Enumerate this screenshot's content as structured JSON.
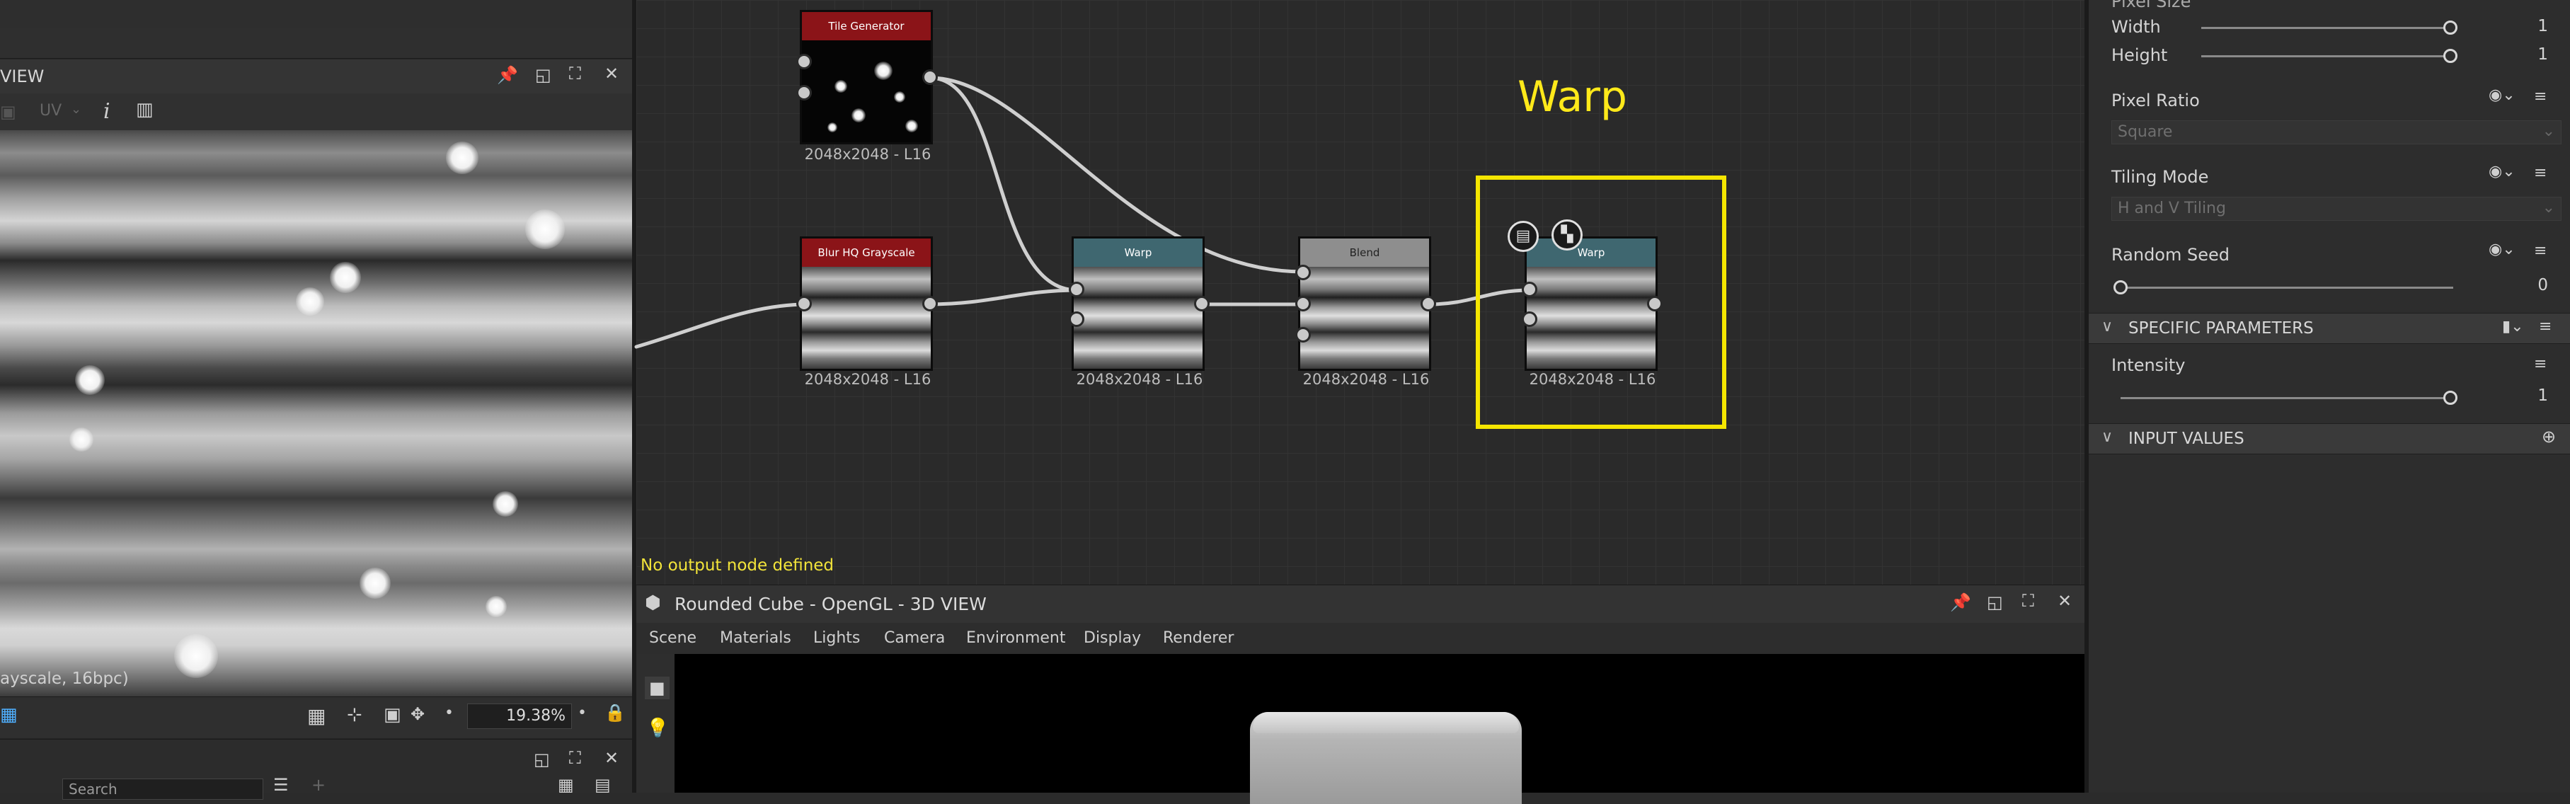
{
  "left_view": {
    "title": "VIEW",
    "uv_label": "UV",
    "status": "ayscale, 16bpc)",
    "zoom": "19.38%",
    "search_placeholder": "Search"
  },
  "graph": {
    "comment": "Warp",
    "no_output": "No output node defined",
    "nodes": [
      {
        "name": "Tile Generator",
        "color": "#8b1418",
        "label": "2048x2048 - L16"
      },
      {
        "name": "Blur HQ Grayscale",
        "color": "#8b1418",
        "label": "2048x2048 - L16"
      },
      {
        "name": "Warp",
        "color": "#3f6770",
        "label": "2048x2048 - L16"
      },
      {
        "name": "Blend",
        "color": "#8e8e8e",
        "label": "2048x2048 - L16"
      },
      {
        "name": "Warp",
        "color": "#3f6770",
        "label": "2048x2048 - L16"
      }
    ]
  },
  "view3d": {
    "title": "Rounded Cube - OpenGL - 3D VIEW",
    "menu": [
      "Scene",
      "Materials",
      "Lights",
      "Camera",
      "Environment",
      "Display",
      "Renderer"
    ]
  },
  "props": {
    "pixel_size_label": "Pixel Size",
    "width_label": "Width",
    "width_value": "1",
    "height_label": "Height",
    "height_value": "1",
    "pixel_ratio_label": "Pixel Ratio",
    "pixel_ratio_value": "Square",
    "tiling_mode_label": "Tiling Mode",
    "tiling_mode_value": "H and V Tiling",
    "random_seed_label": "Random Seed",
    "random_seed_value": "0",
    "specific_section": "SPECIFIC PARAMETERS",
    "intensity_label": "Intensity",
    "intensity_value": "1",
    "input_section": "INPUT VALUES"
  }
}
